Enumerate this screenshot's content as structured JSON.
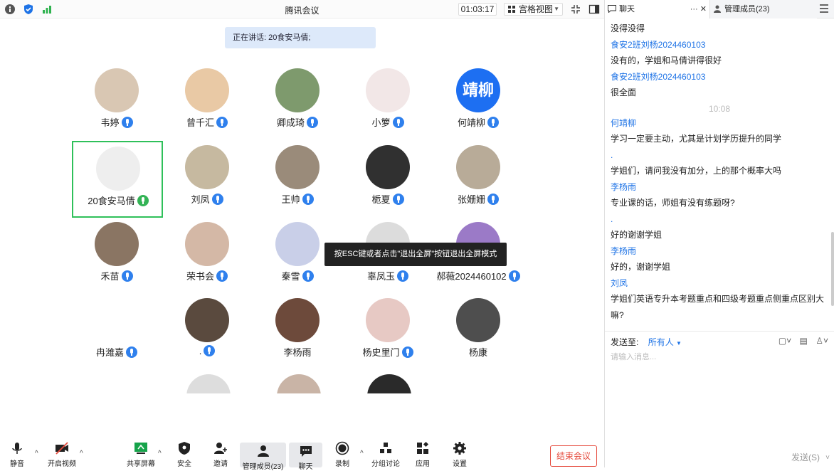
{
  "window": {
    "title": "腾讯会议"
  },
  "topbar": {
    "timer": "01:03:17",
    "grid_view": "宫格视图"
  },
  "speaker_banner": "正在讲话: 20食安马倩;",
  "participants": [
    {
      "name": "韦婷",
      "avatar_color": "#d9c7b3"
    },
    {
      "name": "曾千汇",
      "avatar_color": "#e9c9a5"
    },
    {
      "name": "卿成琦",
      "avatar_color": "#7e9a6d"
    },
    {
      "name": "小箩",
      "avatar_color": "#f2e7e7"
    },
    {
      "name": "何靖柳",
      "avatar_color": "#1d6ff2",
      "avatar_text": "靖柳"
    },
    {
      "name": "20食安马倩",
      "avatar_color": "#eeeeee"
    },
    {
      "name": "刘凤",
      "avatar_color": "#c6b9a0"
    },
    {
      "name": "王帅",
      "avatar_color": "#9a8b7a"
    },
    {
      "name": "栀夏",
      "avatar_color": "#303030"
    },
    {
      "name": "张姗姗",
      "avatar_color": "#b8ab98"
    },
    {
      "name": "禾苗",
      "avatar_color": "#8a7563"
    },
    {
      "name": "荣书会",
      "avatar_color": "#d4b8a6"
    },
    {
      "name": "秦雪",
      "avatar_color": "#c9cfe8"
    },
    {
      "name": "辜凤玉",
      "avatar_color": "#dcdcdc"
    },
    {
      "name": "郝薇2024460102",
      "avatar_color": "#9b7ac7"
    },
    {
      "name": "冉潍嘉",
      "avatar_color": "#ffffff"
    },
    {
      "name": ".",
      "avatar_color": "#5a4a3e"
    },
    {
      "name": "李杨雨",
      "avatar_color": "#6d4a3b"
    },
    {
      "name": "杨史里门",
      "avatar_color": "#e7c9c4"
    },
    {
      "name": "杨康",
      "avatar_color": "#4e4e4e"
    }
  ],
  "toast": "按ESC键或者点击\"退出全屏\"按钮退出全屏模式",
  "toolbar": {
    "mute": "静音",
    "video": "开启视频",
    "share": "共享屏幕",
    "security": "安全",
    "invite": "邀请",
    "members": "管理成员(23)",
    "chat": "聊天",
    "record": "录制",
    "breakout": "分组讨论",
    "apps": "应用",
    "settings": "设置",
    "end": "结束会议"
  },
  "panel": {
    "chat_tab": "聊天",
    "members_tab": "管理成员(23)",
    "messages": [
      {
        "type": "text",
        "text": "没得没得"
      },
      {
        "type": "name",
        "text": "食安2班刘杨2024460103"
      },
      {
        "type": "text",
        "text": "没有的，学姐和马倩讲得很好"
      },
      {
        "type": "name",
        "text": "食安2班刘杨2024460103"
      },
      {
        "type": "text",
        "text": "很全面"
      },
      {
        "type": "time",
        "text": "10:08"
      },
      {
        "type": "name",
        "text": "何靖柳"
      },
      {
        "type": "text",
        "text": "学习一定要主动，尤其是计划学历提升的同学"
      },
      {
        "type": "name",
        "text": "."
      },
      {
        "type": "text",
        "text": "学姐们，请问我没有加分，上的那个概率大吗"
      },
      {
        "type": "name",
        "text": "李杨雨"
      },
      {
        "type": "text",
        "text": "专业课的话，师姐有没有练题呀?"
      },
      {
        "type": "name",
        "text": "."
      },
      {
        "type": "text",
        "text": "好的谢谢学姐"
      },
      {
        "type": "name",
        "text": "李杨雨"
      },
      {
        "type": "text",
        "text": "好的，谢谢学姐"
      },
      {
        "type": "name",
        "text": "刘凤"
      },
      {
        "type": "text",
        "text": "学姐们英语专升本考题重点和四级考题重点侧重点区别大"
      },
      {
        "type": "text",
        "text": "嘛?"
      }
    ],
    "send_to_label": "发送至:",
    "send_to_target": "所有人",
    "input_placeholder": "请输入消息...",
    "send_label": "发送(S)"
  },
  "colors": {
    "accent": "#1e73e6",
    "mic": "#2f80ed",
    "active": "#2fc05a",
    "end": "#e5483a"
  }
}
